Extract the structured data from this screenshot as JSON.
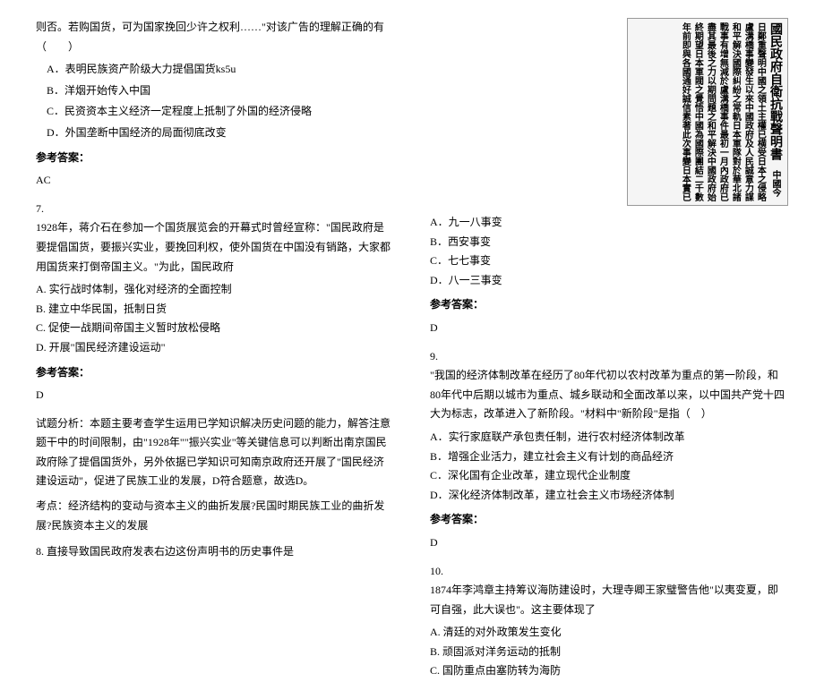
{
  "left": {
    "q6_intro": "则否。若购国货，可为国家挽回少许之权利……\"对该广告的理解正确的有（　　）",
    "q6_optA": "A．表明民族资产阶级大力提倡国货ks5u",
    "q6_optB": "B．洋烟开始传入中国",
    "q6_optC": "C．民资资本主义经济一定程度上抵制了外国的经济侵略",
    "q6_optD": "D．外国垄断中国经济的局面彻底改变",
    "answer_label": "参考答案：",
    "q6_answer": "AC",
    "q7_num": "7.",
    "q7_text": "1928年，蒋介石在参加一个国货展览会的开幕式时曾经宣称：\"国民政府是要提倡国货，要振兴实业，要挽回利权，使外国货在中国没有销路，大家都用国货来打倒帝国主义。\"为此，国民政府",
    "q7_optA": "A. 实行战时体制，强化对经济的全面控制",
    "q7_optB": "B. 建立中华民国，抵制日货",
    "q7_optC": "C. 促使一战期间帝国主义暂时放松侵略",
    "q7_optD": "D. 开展\"国民经济建设运动\"",
    "q7_answer": "D",
    "q7_analysis1": "试题分析：本题主要考查学生运用已学知识解决历史问题的能力，解答注意题干中的时间限制，由\"1928年\"\"振兴实业\"等关键信息可以判断出南京国民政府除了提倡国货外，另外依据已学知识可知南京政府还开展了\"国民经济建设运动\"，促进了民族工业的发展，D符合题意，故选D。",
    "q7_analysis2": "考点：经济结构的变动与资本主义的曲折发展?民国时期民族工业的曲折发展?民族资本主义的发展",
    "q8_text": "8. 直接导致国民政府发表右边这份声明书的历史事件是"
  },
  "right": {
    "image_title": "國民政府自衛抗戰聲明書",
    "image_body": "中國今日鄭重聲明中國之領土主權已横受日本之侵略盧溝橋事變發生以來中國政府及人民誠意力謀和平解決國際糾紛之常軌日本軍隊對於華北諸戰事有增無減於盧溝橋事件最初一月內政府已盡其最後之力以期問題之和平解決中國政府始終期望日本軍閥之覺悟中國為國際團結二千數年前即與各國通好誠信素著此次事變日本實已",
    "q8_optA": "A．九一八事变",
    "q8_optB": "B．西安事变",
    "q8_optC": "C．七七事变",
    "q8_optD": "D．八一三事变",
    "answer_label": "参考答案：",
    "q8_answer": "D",
    "q9_num": "9.",
    "q9_text": "\"我国的经济体制改革在经历了80年代初以农村改革为重点的第一阶段，和80年代中后期以城市为重点、城乡联动和全面改革以来，以中国共产党十四大为标志，改革进入了新阶段。\"材料中\"新阶段\"是指（　）",
    "q9_optA": "A．实行家庭联产承包责任制，进行农村经济体制改革",
    "q9_optB": "B．增强企业活力，建立社会主义有计划的商品经济",
    "q9_optC": "C．深化国有企业改革，建立现代企业制度",
    "q9_optD": "D．深化经济体制改革，建立社会主义市场经济体制",
    "q9_answer": "D",
    "q10_num": "10.",
    "q10_text": "1874年李鸿章主持筹议海防建设时，大理寺卿王家璧警告他\"以夷变夏，即可自强，此大误也\"。这主要体现了",
    "q10_optA": "A. 清廷的对外政策发生变化",
    "q10_optB": "B. 顽固派对洋务运动的抵制",
    "q10_optC": "C. 国防重点由塞防转为海防"
  }
}
